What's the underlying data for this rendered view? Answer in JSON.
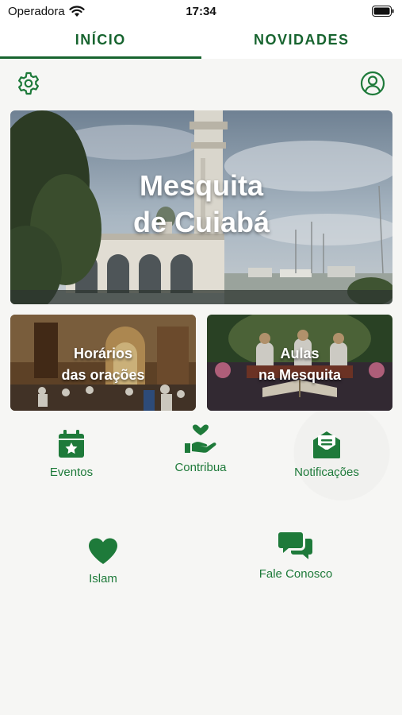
{
  "status": {
    "carrier": "Operadora",
    "time": "17:34"
  },
  "tabs": [
    {
      "label": "INÍCIO",
      "active": true
    },
    {
      "label": "NOVIDADES",
      "active": false
    }
  ],
  "header": {
    "settings_icon": "gear-icon",
    "profile_icon": "user-circle-icon"
  },
  "hero": {
    "line1": "Mesquita",
    "line2": "de Cuiabá"
  },
  "cards": [
    {
      "line1": "Horários",
      "line2": "das orações"
    },
    {
      "line1": "Aulas",
      "line2": "na Mesquita"
    }
  ],
  "menu": [
    {
      "label": "Eventos",
      "icon": "calendar-star-icon"
    },
    {
      "label": "Contribua",
      "icon": "hand-heart-icon"
    },
    {
      "label": "Notificações",
      "icon": "envelope-open-icon"
    },
    {
      "label": "Islam",
      "icon": "heart-icon"
    },
    {
      "label": "Fale Conosco",
      "icon": "chat-bubbles-icon"
    }
  ],
  "colors": {
    "brand_green": "#17642f",
    "icon_green": "#1e7a3a",
    "background": "#f6f6f4"
  }
}
